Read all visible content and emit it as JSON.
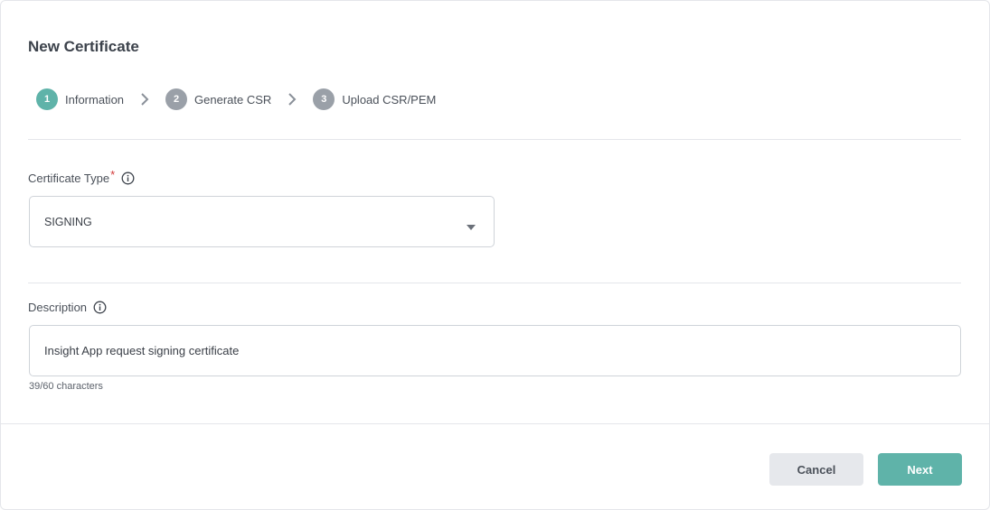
{
  "dialog": {
    "title": "New Certificate"
  },
  "stepper": {
    "steps": [
      {
        "number": "1",
        "label": "Information",
        "state": "active"
      },
      {
        "number": "2",
        "label": "Generate CSR",
        "state": "inactive"
      },
      {
        "number": "3",
        "label": "Upload CSR/PEM",
        "state": "inactive"
      }
    ]
  },
  "certificate_type": {
    "label": "Certificate Type",
    "required_marker": "*",
    "selected_value": "SIGNING"
  },
  "description": {
    "label": "Description",
    "value": "Insight App request signing certificate",
    "char_count": "39/60 characters"
  },
  "footer": {
    "cancel_label": "Cancel",
    "next_label": "Next"
  },
  "colors": {
    "accent": "#5fb3a9",
    "inactive_step": "#9aa0a8",
    "required": "#d23a3a"
  },
  "icons": {
    "info": "info-circle-icon",
    "caret": "caret-down-icon",
    "chevron": "chevron-right-icon"
  }
}
